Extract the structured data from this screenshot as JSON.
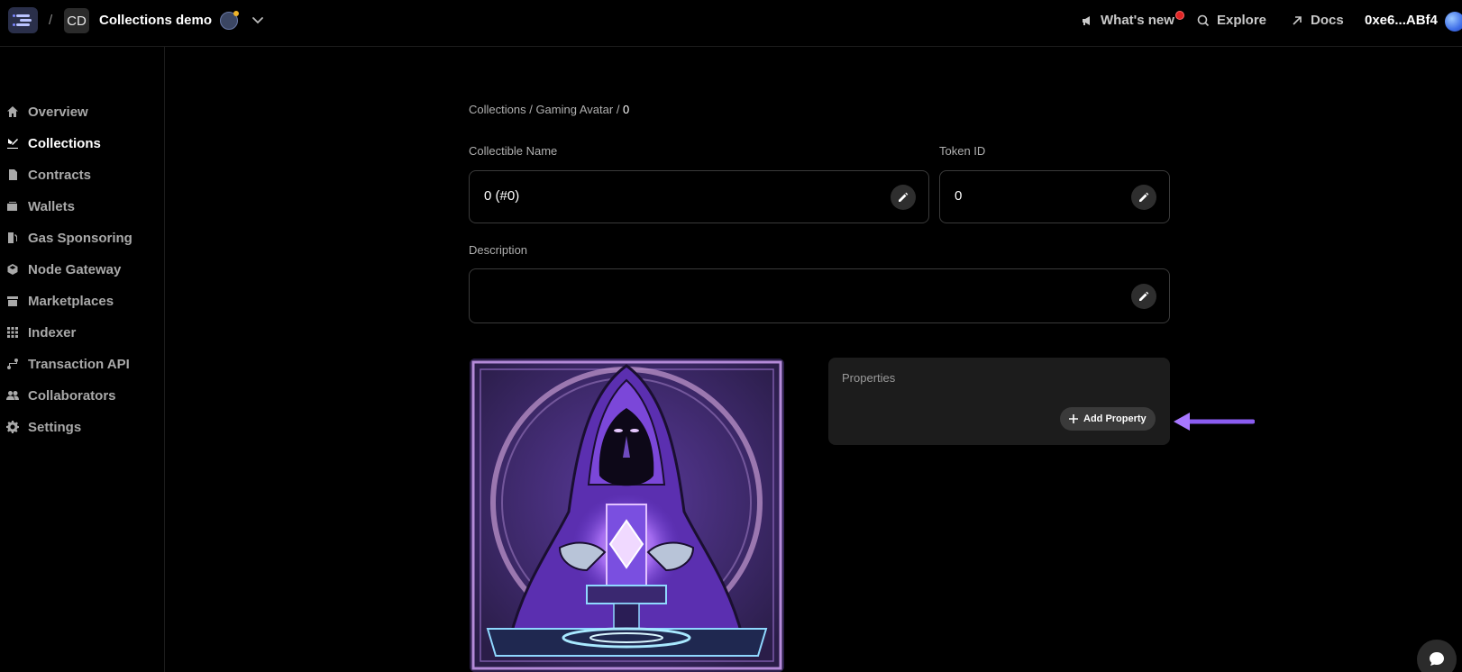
{
  "header": {
    "separator": "/",
    "project_badge": "CD",
    "project_name": "Collections demo",
    "whats_new": "What's new",
    "explore": "Explore",
    "docs": "Docs",
    "address": "0xe6...ABf4"
  },
  "sidebar": {
    "items": [
      {
        "label": "Overview",
        "icon": "home-icon"
      },
      {
        "label": "Collections",
        "icon": "collections-icon",
        "active": true
      },
      {
        "label": "Contracts",
        "icon": "contract-icon"
      },
      {
        "label": "Wallets",
        "icon": "wallet-icon"
      },
      {
        "label": "Gas Sponsoring",
        "icon": "gas-pump-icon"
      },
      {
        "label": "Node Gateway",
        "icon": "cube-icon"
      },
      {
        "label": "Marketplaces",
        "icon": "store-icon"
      },
      {
        "label": "Indexer",
        "icon": "grid-icon"
      },
      {
        "label": "Transaction API",
        "icon": "route-icon"
      },
      {
        "label": "Collaborators",
        "icon": "users-icon"
      },
      {
        "label": "Settings",
        "icon": "gear-icon"
      }
    ]
  },
  "breadcrumb": {
    "collections": "Collections",
    "sep1": " / ",
    "collection": "Gaming Avatar",
    "sep2": " / ",
    "current": "0"
  },
  "form": {
    "name_label": "Collectible Name",
    "name_value": "0 (#0)",
    "token_label": "Token ID",
    "token_value": "0",
    "description_label": "Description",
    "description_value": ""
  },
  "properties": {
    "title": "Properties",
    "add_label": "Add Property"
  },
  "colors": {
    "accent": "#9b6bff",
    "arrow": "#8a5cf0",
    "notification": "#e02424"
  }
}
